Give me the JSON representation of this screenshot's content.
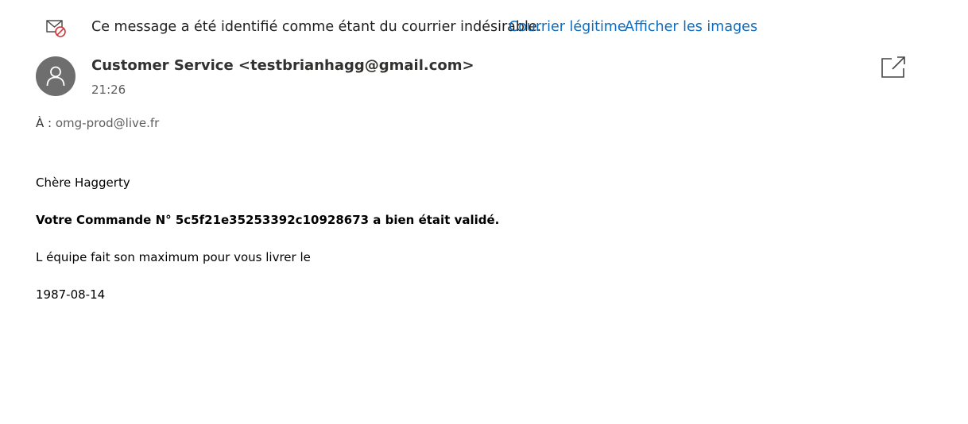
{
  "junk_banner": {
    "icon": "junk-mail-icon",
    "message": "Ce message a été identifié comme étant du courrier indésirable.",
    "legit_link": "Courrier légitime",
    "images_link": "Afficher les images",
    "link_color": "#0f6cbd"
  },
  "header": {
    "sender": "Customer Service <testbrianhagg@gmail.com>",
    "time": "21:26",
    "to_label": "À :",
    "to_address": "omg-prod@live.fr",
    "avatar_color": "#6e6e6e"
  },
  "body": {
    "greeting": "Chère Haggerty",
    "order_line": "Votre Commande N° 5c5f21e35253392c10928673 a bien était validé.",
    "delivery_line": "L équipe fait son maximum pour vous livrer le",
    "date": "1987-08-14"
  }
}
